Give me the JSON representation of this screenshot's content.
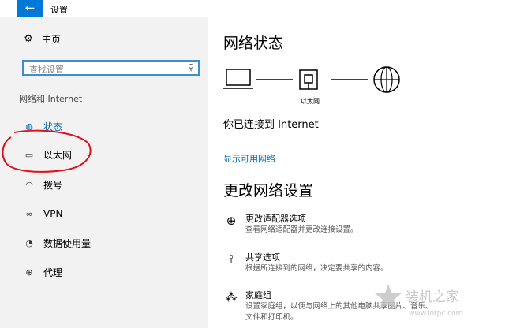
{
  "app": {
    "title": "设置",
    "back_icon": "←"
  },
  "sidebar": {
    "home_label": "主页",
    "search_placeholder": "查找设置",
    "section_title": "网络和 Internet",
    "items": [
      {
        "label": "状态",
        "icon": "globe-icon",
        "glyph": "◍",
        "active": true
      },
      {
        "label": "以太网",
        "icon": "ethernet-icon",
        "glyph": "▭",
        "active": false
      },
      {
        "label": "拨号",
        "icon": "dialup-icon",
        "glyph": "◠",
        "active": false
      },
      {
        "label": "VPN",
        "icon": "vpn-icon",
        "glyph": "∞",
        "active": false
      },
      {
        "label": "数据使用量",
        "icon": "data-usage-icon",
        "glyph": "◔",
        "active": false
      },
      {
        "label": "代理",
        "icon": "proxy-icon",
        "glyph": "⊕",
        "active": false
      }
    ]
  },
  "main": {
    "title": "网络状态",
    "diagram_label": "以太网",
    "connected_text": "你已连接到 Internet",
    "show_networks_link": "显示可用网络",
    "change_title": "更改网络设置",
    "options": [
      {
        "title": "更改适配器选项",
        "desc": "查看网络适配器并更改连接设置。",
        "icon": "adapter-icon"
      },
      {
        "title": "共享选项",
        "desc": "根据所连接到的网络，决定要共享的内容。",
        "icon": "sharing-icon"
      },
      {
        "title": "家庭组",
        "desc": "设置家庭组，以便与网络上的其他电脑共享图片、音乐、文件和打印机。",
        "icon": "homegroup-icon"
      }
    ]
  },
  "watermark": {
    "text": "装机之家",
    "url": "www.lotpc.com"
  },
  "colors": {
    "accent": "#0078d7",
    "sidebar_bg": "#f2f2f2",
    "link": "#0067b8",
    "annotation": "#e0101a"
  }
}
